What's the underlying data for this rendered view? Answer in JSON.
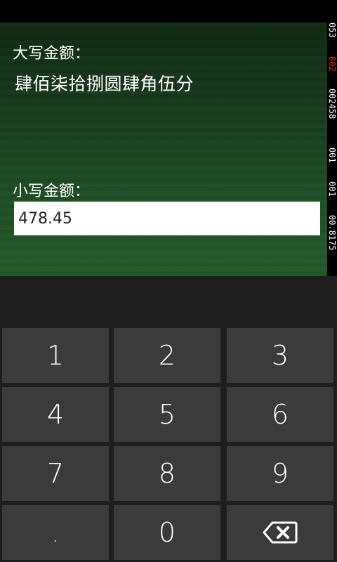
{
  "upper": {
    "label": "大写金额：",
    "value": "肆佰柒拾捌圆肆角伍分"
  },
  "lower": {
    "label": "小写金额：",
    "value": "478.45"
  },
  "debug": [
    "053",
    "002",
    "002458",
    "001",
    "001",
    "00.8175"
  ],
  "keypad": {
    "keys": [
      "1",
      "2",
      "3",
      "4",
      "5",
      "6",
      "7",
      "8",
      "9",
      ".",
      "0"
    ],
    "backspace_icon": "backspace-icon"
  },
  "colors": {
    "background_top": "#0f2a14",
    "background_bottom": "#245a2a",
    "key_bg": "#3b3b3b",
    "keypad_area": "#1e1e1e",
    "debug_accent": "#e2342a"
  }
}
